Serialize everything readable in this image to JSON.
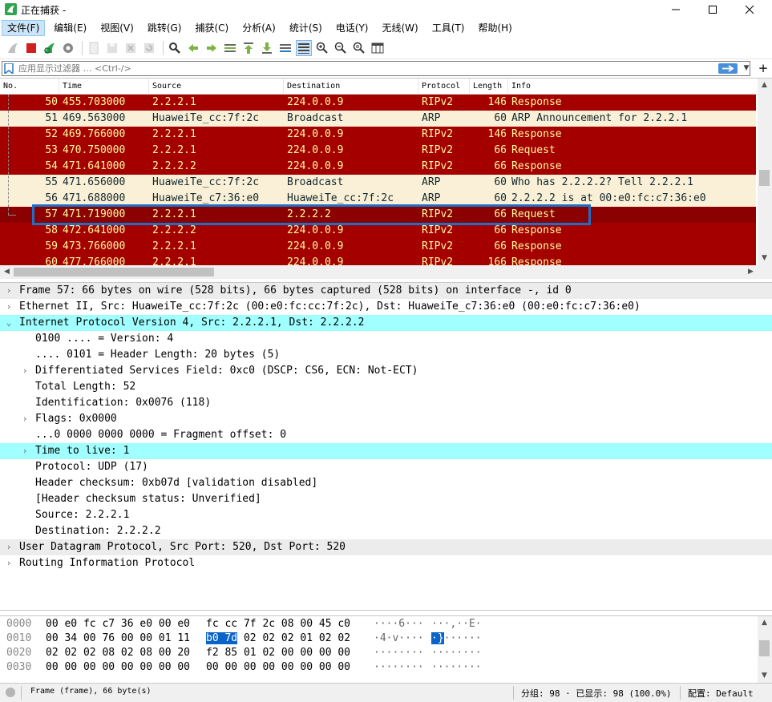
{
  "window": {
    "title": "正在捕获 -"
  },
  "menu": [
    "文件(F)",
    "编辑(E)",
    "视图(V)",
    "跳转(G)",
    "捕获(C)",
    "分析(A)",
    "统计(S)",
    "电话(Y)",
    "无线(W)",
    "工具(T)",
    "帮助(H)"
  ],
  "filter": {
    "placeholder": "应用显示过滤器 … <Ctrl-/>"
  },
  "packet_list": {
    "columns": [
      "No.",
      "Time",
      "Source",
      "Destination",
      "Protocol",
      "Length",
      "Info"
    ],
    "rows": [
      {
        "no": "50",
        "time": "455.703000",
        "src": "2.2.2.1",
        "dst": "224.0.0.9",
        "proto": "RIPv2",
        "len": "146",
        "info": "Response",
        "color": "rip"
      },
      {
        "no": "51",
        "time": "469.563000",
        "src": "HuaweiTe_cc:7f:2c",
        "dst": "Broadcast",
        "proto": "ARP",
        "len": "60",
        "info": "ARP Announcement for 2.2.2.1",
        "color": "arp"
      },
      {
        "no": "52",
        "time": "469.766000",
        "src": "2.2.2.1",
        "dst": "224.0.0.9",
        "proto": "RIPv2",
        "len": "146",
        "info": "Response",
        "color": "rip"
      },
      {
        "no": "53",
        "time": "470.750000",
        "src": "2.2.2.1",
        "dst": "224.0.0.9",
        "proto": "RIPv2",
        "len": "66",
        "info": "Request",
        "color": "rip"
      },
      {
        "no": "54",
        "time": "471.641000",
        "src": "2.2.2.2",
        "dst": "224.0.0.9",
        "proto": "RIPv2",
        "len": "66",
        "info": "Response",
        "color": "rip"
      },
      {
        "no": "55",
        "time": "471.656000",
        "src": "HuaweiTe_cc:7f:2c",
        "dst": "Broadcast",
        "proto": "ARP",
        "len": "60",
        "info": "Who has 2.2.2.2? Tell 2.2.2.1",
        "color": "arp"
      },
      {
        "no": "56",
        "time": "471.688000",
        "src": "HuaweiTe_c7:36:e0",
        "dst": "HuaweiTe_cc:7f:2c",
        "proto": "ARP",
        "len": "60",
        "info": "2.2.2.2 is at 00:e0:fc:c7:36:e0",
        "color": "arp"
      },
      {
        "no": "57",
        "time": "471.719000",
        "src": "2.2.2.1",
        "dst": "2.2.2.2",
        "proto": "RIPv2",
        "len": "66",
        "info": "Request",
        "color": "sel"
      },
      {
        "no": "58",
        "time": "472.641000",
        "src": "2.2.2.2",
        "dst": "224.0.0.9",
        "proto": "RIPv2",
        "len": "66",
        "info": "Response",
        "color": "rip"
      },
      {
        "no": "59",
        "time": "473.766000",
        "src": "2.2.2.1",
        "dst": "224.0.0.9",
        "proto": "RIPv2",
        "len": "66",
        "info": "Response",
        "color": "rip"
      },
      {
        "no": "60",
        "time": "477.766000",
        "src": "2.2.2.1",
        "dst": "224.0.0.9",
        "proto": "RIPv2",
        "len": "166",
        "info": "Response",
        "color": "rip"
      }
    ]
  },
  "details": [
    {
      "text": "Frame 57: 66 bytes on wire (528 bits), 66 bytes captured (528 bits) on interface -, id 0",
      "level": 0,
      "toggle": ">",
      "style": "band"
    },
    {
      "text": "Ethernet II, Src: HuaweiTe_cc:7f:2c (00:e0:fc:cc:7f:2c), Dst: HuaweiTe_c7:36:e0 (00:e0:fc:c7:36:e0)",
      "level": 0,
      "toggle": ">",
      "style": ""
    },
    {
      "text": "Internet Protocol Version 4, Src: 2.2.2.1, Dst: 2.2.2.2",
      "level": 0,
      "toggle": "v",
      "style": "hl"
    },
    {
      "text": "0100 .... = Version: 4",
      "level": 1,
      "toggle": "",
      "style": ""
    },
    {
      "text": ".... 0101 = Header Length: 20 bytes (5)",
      "level": 1,
      "toggle": "",
      "style": ""
    },
    {
      "text": "Differentiated Services Field: 0xc0 (DSCP: CS6, ECN: Not-ECT)",
      "level": 1,
      "toggle": ">",
      "style": ""
    },
    {
      "text": "Total Length: 52",
      "level": 1,
      "toggle": "",
      "style": ""
    },
    {
      "text": "Identification: 0x0076 (118)",
      "level": 1,
      "toggle": "",
      "style": ""
    },
    {
      "text": "Flags: 0x0000",
      "level": 1,
      "toggle": ">",
      "style": ""
    },
    {
      "text": "...0 0000 0000 0000 = Fragment offset: 0",
      "level": 1,
      "toggle": "",
      "style": ""
    },
    {
      "text": "Time to live: 1",
      "level": 1,
      "toggle": ">",
      "style": "hl"
    },
    {
      "text": "Protocol: UDP (17)",
      "level": 1,
      "toggle": "",
      "style": ""
    },
    {
      "text": "Header checksum: 0xb07d [validation disabled]",
      "level": 1,
      "toggle": "",
      "style": ""
    },
    {
      "text": "[Header checksum status: Unverified]",
      "level": 1,
      "toggle": "",
      "style": ""
    },
    {
      "text": "Source: 2.2.2.1",
      "level": 1,
      "toggle": "",
      "style": ""
    },
    {
      "text": "Destination: 2.2.2.2",
      "level": 1,
      "toggle": "",
      "style": ""
    },
    {
      "text": "User Datagram Protocol, Src Port: 520, Dst Port: 520",
      "level": 0,
      "toggle": ">",
      "style": "band"
    },
    {
      "text": "Routing Information Protocol",
      "level": 0,
      "toggle": ">",
      "style": ""
    }
  ],
  "bytes": [
    {
      "offset": "0000",
      "hex1": "00 e0 fc c7 36 e0 00 e0",
      "hex2": "fc cc 7f 2c 08 00 45 c0",
      "hl_hex": "",
      "hex2_rest": "",
      "asc1": "····6···",
      "asc2": "···,··E·",
      "hl_asc": "",
      "asc2_rest": ""
    },
    {
      "offset": "0010",
      "hex1": "00 34 00 76 00 00 01 11",
      "hex2": "",
      "hl_hex": "b0 7d",
      "hex2_rest": " 02 02 02 01 02 02",
      "asc1": "·4·v····",
      "asc2": "",
      "hl_asc": "·}",
      "asc2_rest": "······"
    },
    {
      "offset": "0020",
      "hex1": "02 02 02 08 02 08 00 20",
      "hex2": "f2 85 01 02 00 00 00 00",
      "hl_hex": "",
      "hex2_rest": "",
      "asc1": "········",
      "asc2": "········",
      "hl_asc": "",
      "asc2_rest": ""
    },
    {
      "offset": "0030",
      "hex1": "00 00 00 00 00 00 00 00",
      "hex2": "00 00 00 00 00 00 00 00",
      "hl_hex": "",
      "hex2_rest": "",
      "asc1": "········",
      "asc2": "········",
      "hl_asc": "",
      "asc2_rest": ""
    }
  ],
  "status": {
    "frame": "Frame (frame), 66 byte(s)",
    "counts": "分组: 98 · 已显示: 98 (100.0%)",
    "profile": "配置: Default"
  },
  "colors": {
    "rip_bg": "#a40000",
    "rip_fg": "#fffc9c",
    "arp_bg": "#faf0d7",
    "highlight": "#a0ffff",
    "selection_box": "#1e6fc8"
  }
}
